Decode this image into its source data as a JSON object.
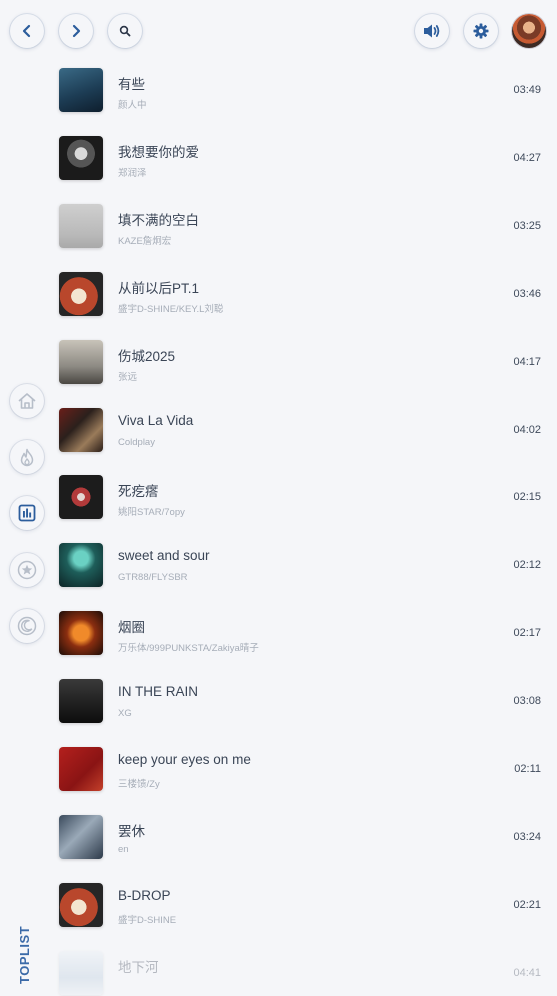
{
  "sidebar": {
    "section_label": "TOPLIST"
  },
  "songs": [
    {
      "title": "有些",
      "artist": "颜人中",
      "duration": "03:49",
      "cover": "linear-gradient(160deg,#3a6a86 0%,#1d3d55 55%,#0e1e2d 100%)"
    },
    {
      "title": "我想要你的爱",
      "artist": "郑润泽",
      "duration": "04:27",
      "cover": "radial-gradient(circle at 50% 40%,#d9d9d9 0 18%,#555 19% 40%,#1b1b1b 41%)"
    },
    {
      "title": "填不满的空白",
      "artist": "KAZE詹炯宏",
      "duration": "03:25",
      "cover": "linear-gradient(180deg,#cfcfcf,#b9b9b9 70%,#a9a9a9)"
    },
    {
      "title": "从前以后PT.1",
      "artist": "盛宇D-SHINE/KEY.L刘聪",
      "duration": "03:46",
      "cover": "radial-gradient(circle at 45% 55%,#f3e5d0 0 22%,#b9472c 23% 55%,#262626 56%)"
    },
    {
      "title": "伤城2025",
      "artist": "张远",
      "duration": "04:17",
      "cover": "linear-gradient(180deg,#c8c3b9,#8d8a83 60%,#4a4742)"
    },
    {
      "title": "Viva La Vida",
      "artist": "Coldplay",
      "duration": "04:02",
      "cover": "linear-gradient(135deg,#6b1f1a,#2b201c 40%,#9a7b5a 70%,#2a1d18)"
    },
    {
      "title": "死疙瘩",
      "artist": "姚阳STAR/7opy",
      "duration": "02:15",
      "cover": "radial-gradient(circle at 50% 50%,#e5d7d3 0 12%,#b23a3a 13% 30%,#1c1c1c 31%)"
    },
    {
      "title": "sweet and sour",
      "artist": "GTR88/FLYSBR",
      "duration": "02:12",
      "cover": "radial-gradient(circle at 50% 35%,#6ad1c3 0 20%,#1e5e5a 40%,#0d2325)"
    },
    {
      "title": "烟圈",
      "artist": "万乐体/999PUNKSTA/Zakiya晴子",
      "duration": "02:17",
      "cover": "radial-gradient(circle at 50% 50%,#f08a2a 0 25%,#8b2e10 45%,#1c0d08)"
    },
    {
      "title": "IN THE RAIN",
      "artist": "XG",
      "duration": "03:08",
      "cover": "linear-gradient(180deg,#3a3a3a,#1e1e1e 60%,#0d0d0d)"
    },
    {
      "title": "keep your eyes on me",
      "artist": "三楼馈/Zy",
      "duration": "02:11",
      "cover": "linear-gradient(135deg,#b4201d,#8a1414 60%,#c4402a)"
    },
    {
      "title": "罢休",
      "artist": "en",
      "duration": "03:24",
      "cover": "linear-gradient(135deg,#3a4a5c,#9aa9b8 45%,#2d3a4a)"
    },
    {
      "title": "B-DROP",
      "artist": "盛宇D-SHINE",
      "duration": "02:21",
      "cover": "radial-gradient(circle at 45% 55%,#f3e5d0 0 22%,#b9472c 23% 55%,#262626 56%)"
    },
    {
      "title": "地下河",
      "artist": "",
      "duration": "04:41",
      "cover": "linear-gradient(180deg,#e8eef4,#b8cbdc 60%,#e6ecf1)"
    }
  ]
}
